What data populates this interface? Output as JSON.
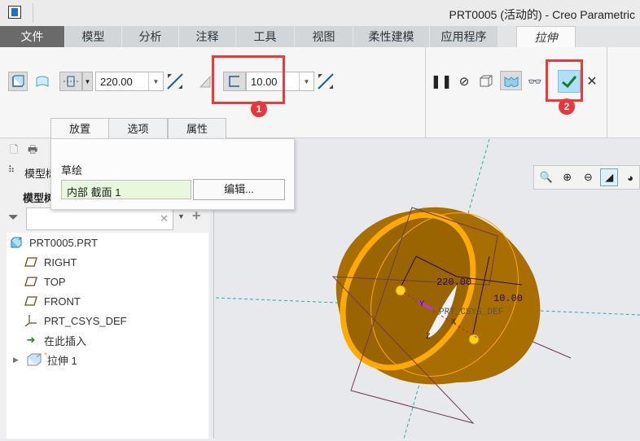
{
  "window": {
    "title": "PRT0005 (活动的) - Creo Parametric"
  },
  "tabs": [
    "文件",
    "模型",
    "分析",
    "注释",
    "工具",
    "视图",
    "柔性建模",
    "应用程序"
  ],
  "active_tab": "拉伸",
  "ribbon": {
    "depth_value": "220.00",
    "thickness_value": "10.00",
    "badge1": "1",
    "badge2": "2"
  },
  "subtabs": [
    "放置",
    "选项",
    "属性"
  ],
  "popup": {
    "label": "草绘",
    "sketch_value": "内部 截面 1",
    "edit_button": "编辑..."
  },
  "panel": {
    "header": "模型树",
    "subheader": "模型树",
    "filter_placeholder": ""
  },
  "tree": [
    {
      "label": "PRT0005.PRT",
      "icon": "part-icon"
    },
    {
      "label": "RIGHT",
      "icon": "datum-plane-icon"
    },
    {
      "label": "TOP",
      "icon": "datum-plane-icon"
    },
    {
      "label": "FRONT",
      "icon": "datum-plane-icon"
    },
    {
      "label": "PRT_CSYS_DEF",
      "icon": "csys-icon"
    },
    {
      "label": "在此插入",
      "icon": "insert-arrow-icon"
    },
    {
      "label": "拉伸 1",
      "icon": "extrude-icon"
    }
  ],
  "graphics": {
    "dim1": "220.00",
    "dim2": "10.00",
    "csys_label": "PRT_CSYS_DEF",
    "axis_x": "X",
    "axis_y": "Y",
    "axis_z": "Z"
  },
  "colors": {
    "accent_red": "#f03a3a",
    "model": "#a86e00",
    "model_edge": "#ffaa00",
    "file_tab": "#6a6a6a"
  }
}
